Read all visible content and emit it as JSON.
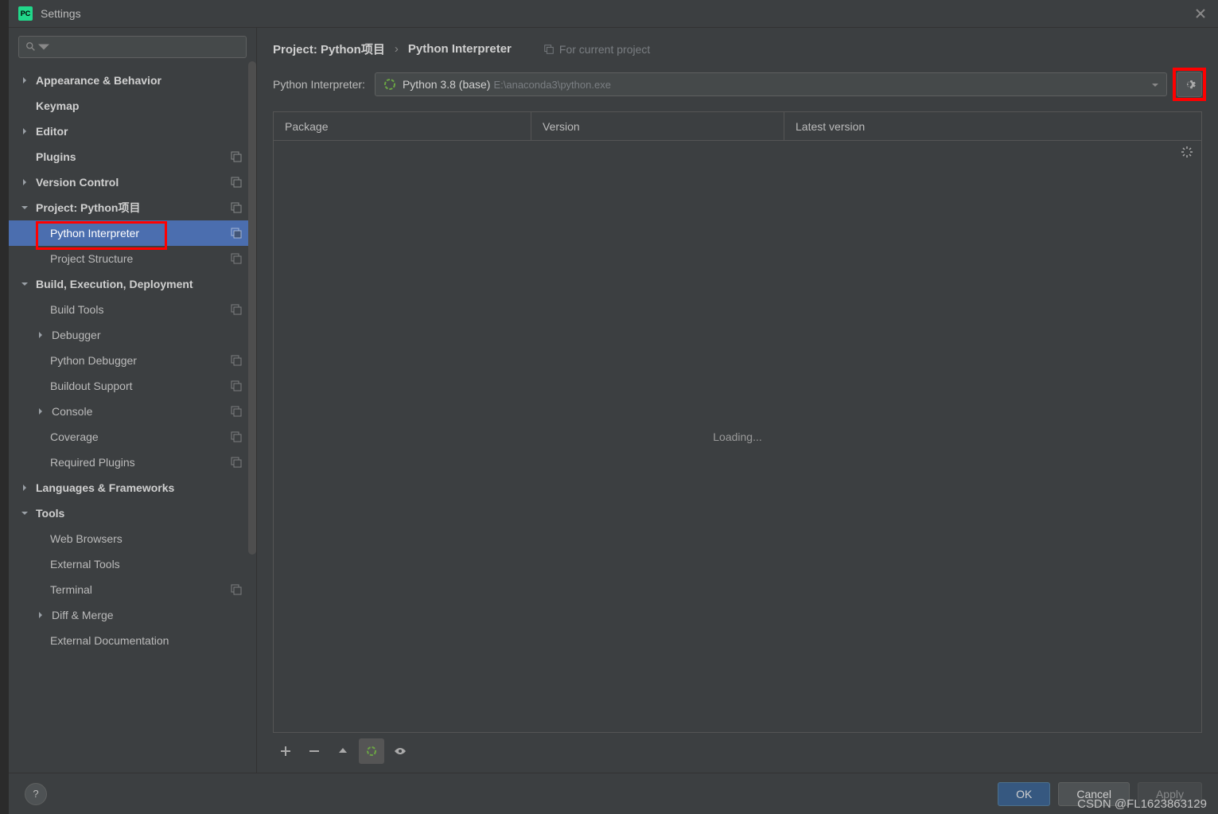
{
  "window": {
    "title": "Settings"
  },
  "search": {
    "placeholder": ""
  },
  "sidebar": {
    "items": [
      {
        "label": "Appearance & Behavior",
        "bold": true,
        "arrow": "right"
      },
      {
        "label": "Keymap",
        "bold": true
      },
      {
        "label": "Editor",
        "bold": true,
        "arrow": "right"
      },
      {
        "label": "Plugins",
        "bold": true,
        "copy": true
      },
      {
        "label": "Version Control",
        "bold": true,
        "arrow": "right",
        "copy": true
      },
      {
        "label": "Project: Python项目",
        "bold": true,
        "arrow": "down",
        "copy": true
      },
      {
        "label": "Python Interpreter",
        "child": true,
        "selected": true,
        "highlighted": true,
        "copy": true
      },
      {
        "label": "Project Structure",
        "child": true,
        "copy": true
      },
      {
        "label": "Build, Execution, Deployment",
        "bold": true,
        "arrow": "down"
      },
      {
        "label": "Build Tools",
        "child": true,
        "copy": true
      },
      {
        "label": "Debugger",
        "child": true,
        "childArrow": "right"
      },
      {
        "label": "Python Debugger",
        "child": true,
        "copy": true
      },
      {
        "label": "Buildout Support",
        "child": true,
        "copy": true
      },
      {
        "label": "Console",
        "child": true,
        "childArrow": "right",
        "copy": true
      },
      {
        "label": "Coverage",
        "child": true,
        "copy": true
      },
      {
        "label": "Required Plugins",
        "child": true,
        "copy": true
      },
      {
        "label": "Languages & Frameworks",
        "bold": true,
        "arrow": "right"
      },
      {
        "label": "Tools",
        "bold": true,
        "arrow": "down"
      },
      {
        "label": "Web Browsers",
        "child": true
      },
      {
        "label": "External Tools",
        "child": true
      },
      {
        "label": "Terminal",
        "child": true,
        "copy": true
      },
      {
        "label": "Diff & Merge",
        "child": true,
        "childArrow": "right"
      },
      {
        "label": "External Documentation",
        "child": true
      }
    ]
  },
  "breadcrumb": {
    "crumb1": "Project: Python项目",
    "sep": "›",
    "crumb2": "Python Interpreter",
    "scope": "For current project"
  },
  "interpreter": {
    "label": "Python Interpreter:",
    "name": "Python 3.8 (base)",
    "path": "E:\\anaconda3\\python.exe"
  },
  "table": {
    "columns": [
      "Package",
      "Version",
      "Latest version"
    ],
    "loading": "Loading..."
  },
  "footer": {
    "help": "?",
    "ok": "OK",
    "cancel": "Cancel",
    "apply": "Apply"
  },
  "watermark": "CSDN @FL1623863129"
}
